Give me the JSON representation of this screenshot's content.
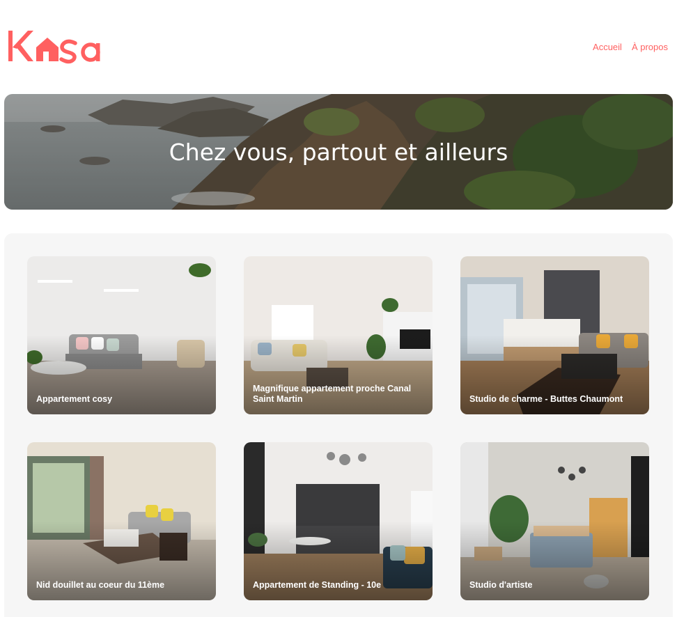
{
  "header": {
    "logo": {
      "text": "Kasa",
      "icon": "house-icon",
      "color": "#ff6060"
    },
    "nav": [
      {
        "label": "Accueil"
      },
      {
        "label": "À propos"
      }
    ]
  },
  "banner": {
    "title": "Chez vous, partout et ailleurs"
  },
  "gallery": {
    "cards": [
      {
        "title": "Appartement cosy"
      },
      {
        "title": "Magnifique appartement proche Canal Saint Martin"
      },
      {
        "title": "Studio de charme - Buttes Chaumont"
      },
      {
        "title": "Nid douillet au coeur du 11ème"
      },
      {
        "title": "Appartement de Standing - 10e"
      },
      {
        "title": "Studio d'artiste"
      }
    ]
  },
  "colors": {
    "accent": "#ff6060",
    "gallery_bg": "#f6f6f6"
  }
}
